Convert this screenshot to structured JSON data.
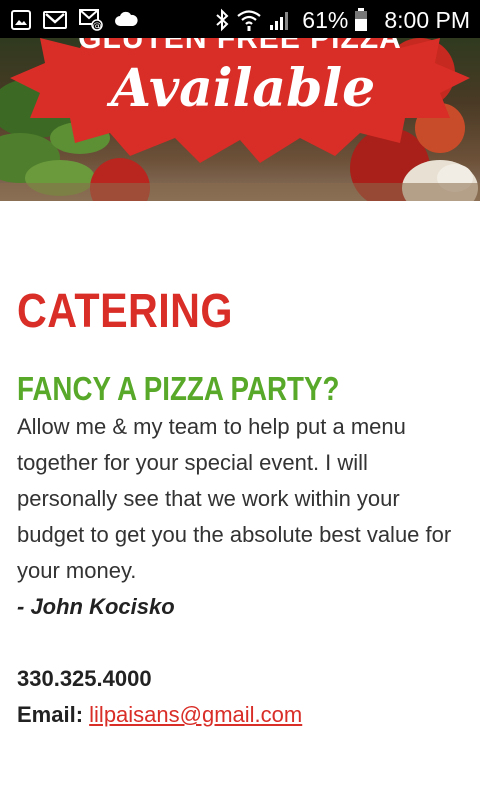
{
  "status_bar": {
    "icons_left": [
      "image-icon",
      "gmail-icon",
      "email-icon",
      "cloud-icon"
    ],
    "icons_right": [
      "bluetooth-icon",
      "wifi-icon",
      "signal-icon",
      "battery-icon"
    ],
    "battery_percent": "61%",
    "battery_level": 0.61,
    "time": "8:00 PM"
  },
  "hero": {
    "badge_top_text": "GLUTEN FREE PIZZA",
    "badge_main_text": "Available",
    "badge_color": "#d92d27"
  },
  "content": {
    "title": "CATERING",
    "subtitle": "FANCY A PIZZA PARTY?",
    "body": "Allow me & my team to help put a menu together for your special event. I will personally see that we work within your budget to get you the absolute best value for your money.",
    "signature": "- John Kocisko",
    "phone": "330.325.4000",
    "email_label": "Email:",
    "email": "lilpaisans@gmail.com"
  },
  "colors": {
    "title_red": "#d92d27",
    "subtitle_green": "#58a82a",
    "body_text": "#333333"
  }
}
